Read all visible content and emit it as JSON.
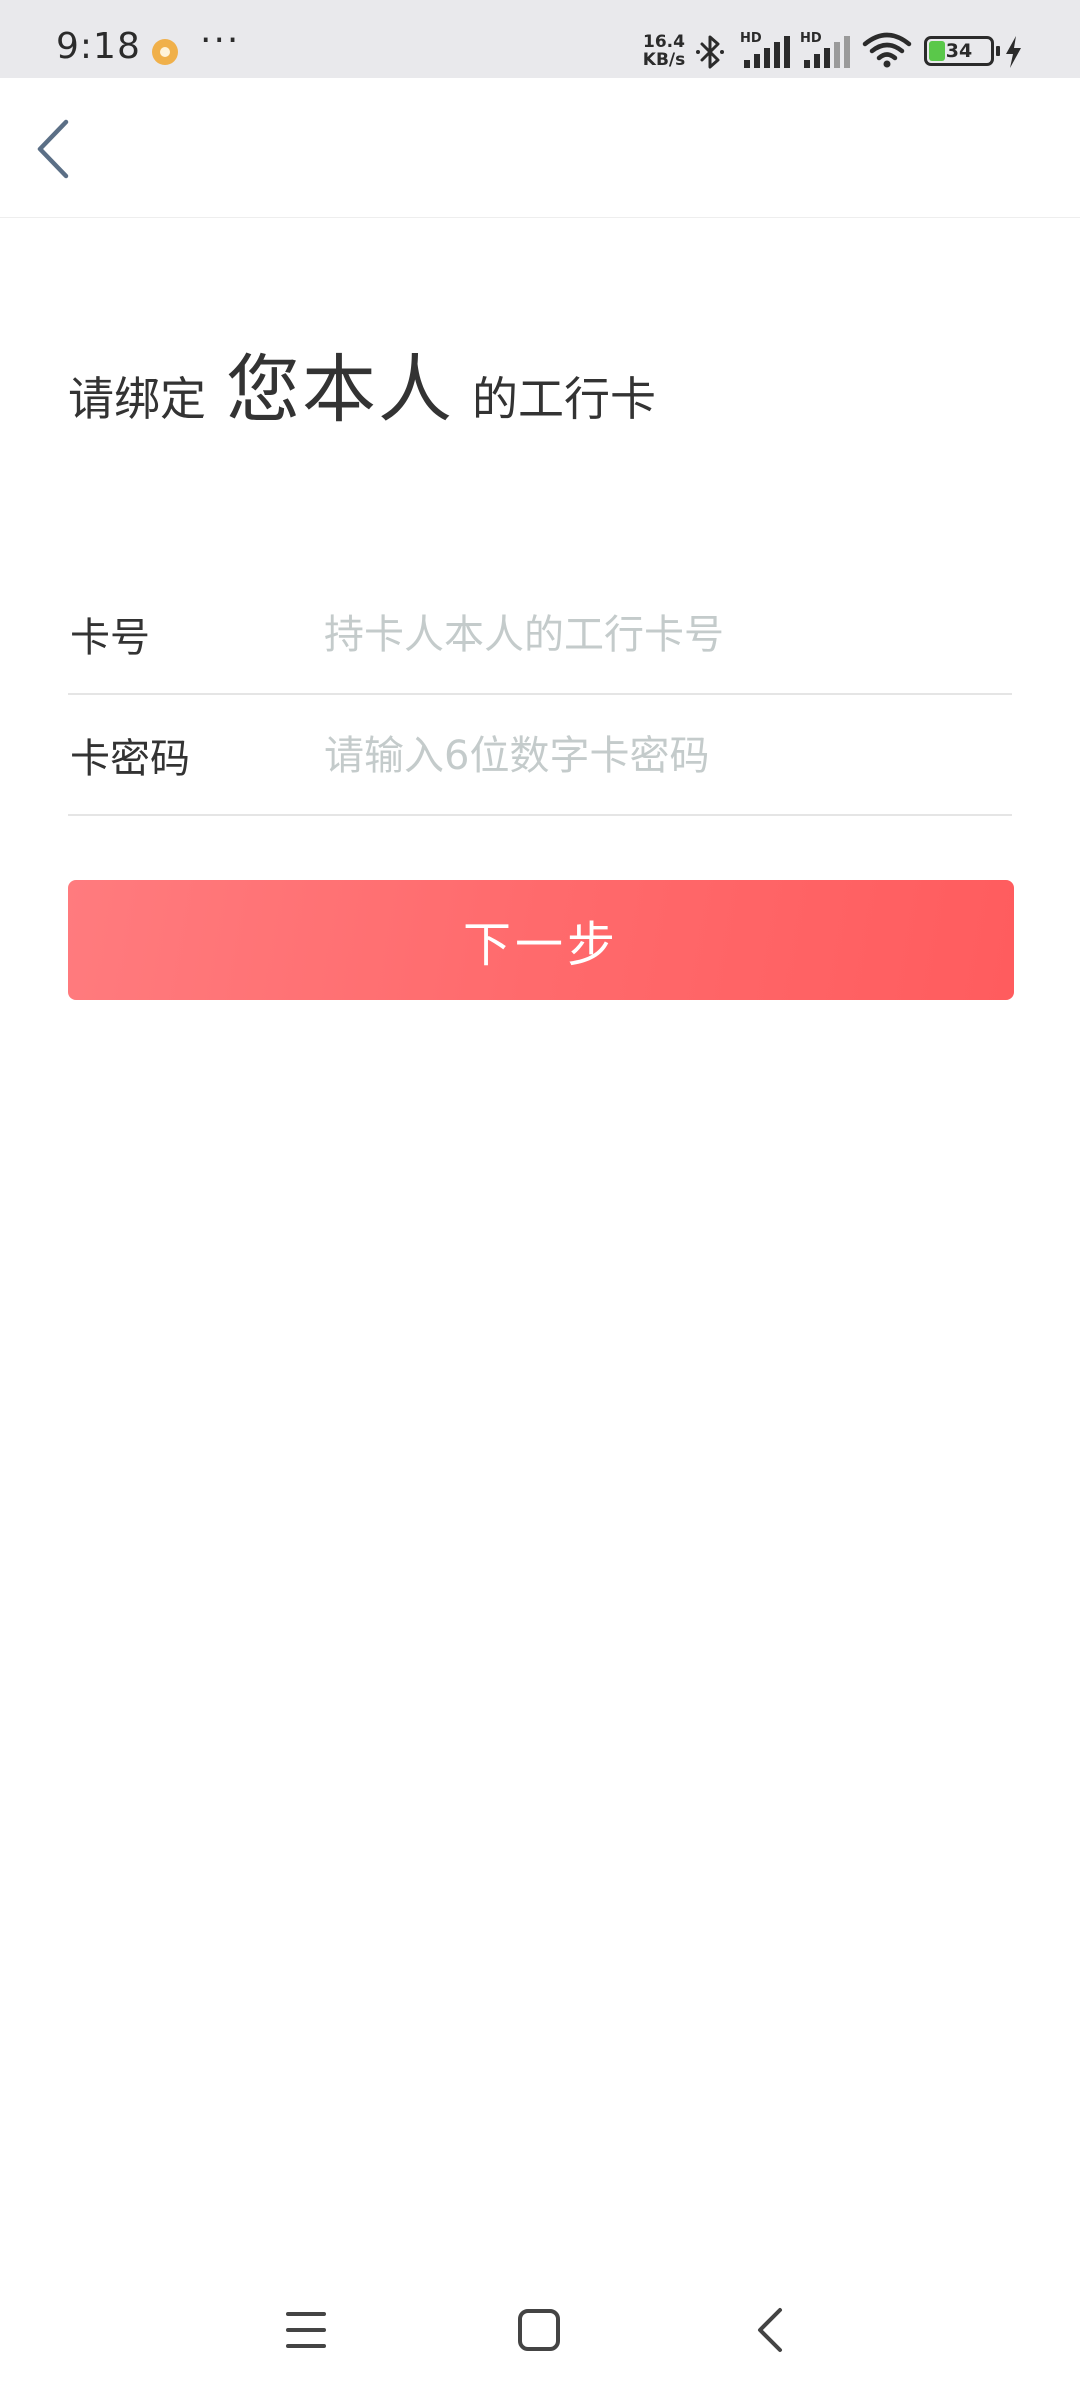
{
  "status_bar": {
    "time": "9:18",
    "more": "···",
    "net_speed_value": "16.4",
    "net_speed_unit": "KB/s",
    "signal_label": "HD",
    "battery_level": "34",
    "icons": [
      "app-notification-icon",
      "bluetooth-icon",
      "signal-icon",
      "wifi-icon",
      "battery-icon",
      "charging-icon"
    ]
  },
  "header": {
    "back_icon": "chevron-left-icon"
  },
  "title": {
    "prefix": "请绑定",
    "emphasis": "您本人",
    "suffix": "的工行卡"
  },
  "form": {
    "card_number": {
      "label": "卡号",
      "value": "",
      "placeholder": "持卡人本人的工行卡号"
    },
    "card_pin": {
      "label": "卡密码",
      "value": "",
      "placeholder": "请输入6位数字卡密码"
    }
  },
  "next_button": {
    "label": "下一步"
  },
  "colors": {
    "accent_gradient_start": "#ff7b7e",
    "accent_gradient_end": "#ff5c5e",
    "placeholder": "#c4cbcb",
    "text": "#333333",
    "status_bar_bg": "#e9e9ec",
    "battery_fill": "#5ac84a"
  },
  "nav_bar": {
    "icons": [
      "menu-icon",
      "home-icon",
      "back-icon"
    ]
  }
}
